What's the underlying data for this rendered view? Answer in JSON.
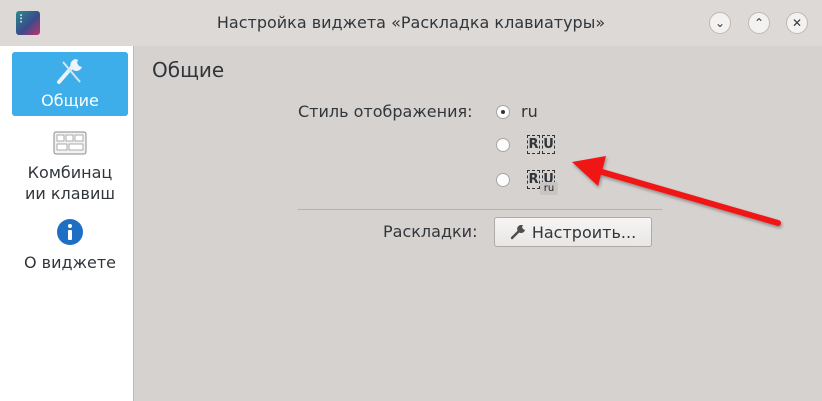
{
  "window": {
    "title": "Настройка виджета «Раскладка клавиатуры»",
    "minimize_glyph": "⌄",
    "maximize_glyph": "⌃",
    "close_glyph": "✕"
  },
  "sidebar": {
    "items": [
      {
        "label": "Общие",
        "icon": "wrench-icon",
        "active": true
      },
      {
        "label": "Комбинац ии клавиш",
        "icon": "keyboard-icon",
        "active": false
      },
      {
        "label": "О виджете",
        "icon": "info-icon",
        "active": false
      }
    ]
  },
  "main": {
    "heading": "Общие",
    "display_style": {
      "label": "Стиль отображения:",
      "options": [
        {
          "text": "ru",
          "selected": true
        },
        {
          "text": "R U",
          "selected": false
        },
        {
          "text": "R U ru",
          "selected": false
        }
      ]
    },
    "layouts": {
      "label": "Раскладки:",
      "button_label": "Настроить..."
    }
  },
  "colors": {
    "accent": "#3daee9",
    "annotation_arrow": "#f01616"
  }
}
